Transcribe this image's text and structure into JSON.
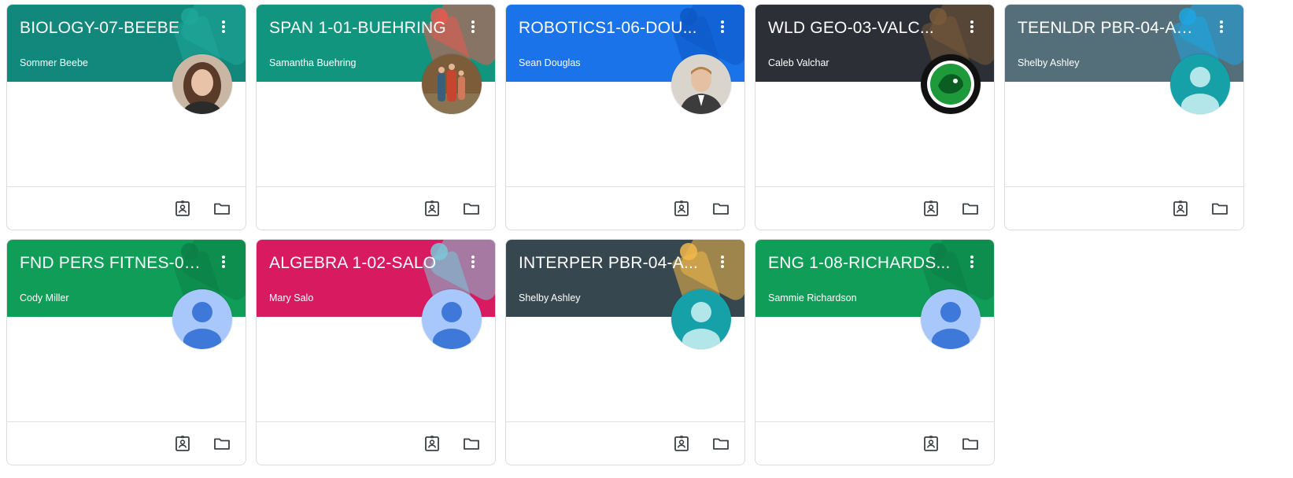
{
  "classes": [
    {
      "title": "BIOLOGY-07-BEEBE",
      "teacher": "Sommer Beebe",
      "header_color": "#12877b",
      "accent_color": "#1fa79a",
      "avatar": "photo-woman",
      "avatar_bg": "#c9b6a3",
      "avatar_fg": "#5a3b2a"
    },
    {
      "title": "SPAN 1-01-BUEHRING",
      "teacher": "Samantha Buehring",
      "header_color": "#12957f",
      "accent_color": "#e85a4f",
      "avatar": "photo-family",
      "avatar_bg": "#7d5c3a",
      "avatar_fg": "#c5452f"
    },
    {
      "title": "ROBOTICS1-06-DOU...",
      "teacher": "Sean Douglas",
      "header_color": "#1a73e8",
      "accent_color": "#0d57c6",
      "avatar": "photo-man",
      "avatar_bg": "#d9d4cc",
      "avatar_fg": "#3c3c3c"
    },
    {
      "title": "WLD GEO-03-VALC...",
      "teacher": "Caleb Valchar",
      "header_color": "#2c2f36",
      "accent_color": "#7a5a3a",
      "avatar": "photo-logo",
      "avatar_bg": "#111111",
      "avatar_fg": "#1e9a3a"
    },
    {
      "title": "TEENLDR PBR-04-AS...",
      "teacher": "Shelby Ashley",
      "header_color": "#546e7a",
      "accent_color": "#1ea6e0",
      "avatar": "default-teal",
      "avatar_bg": "#16a0a8",
      "avatar_fg": "#b2e6e8"
    },
    {
      "title": "FND PERS FITNES-05...",
      "teacher": "Cody Miller",
      "header_color": "#0f9d58",
      "accent_color": "#0c7f47",
      "avatar": "default-blue",
      "avatar_bg": "#a8c7fa",
      "avatar_fg": "#3e78d9"
    },
    {
      "title": "ALGEBRA 1-02-SALO",
      "teacher": "Mary Salo",
      "header_color": "#d81b60",
      "accent_color": "#7cc7d9",
      "avatar": "default-blue",
      "avatar_bg": "#a8c7fa",
      "avatar_fg": "#3e78d9"
    },
    {
      "title": "INTERPER PBR-04-A...",
      "teacher": "Shelby Ashley",
      "header_color": "#37474f",
      "accent_color": "#f2b84b",
      "avatar": "default-teal",
      "avatar_bg": "#16a0a8",
      "avatar_fg": "#b2e6e8"
    },
    {
      "title": "ENG 1-08-RICHARDS...",
      "teacher": "Sammie Richardson",
      "header_color": "#0f9d58",
      "accent_color": "#0c7f47",
      "avatar": "default-blue",
      "avatar_bg": "#a8c7fa",
      "avatar_fg": "#3e78d9"
    }
  ],
  "icons": {
    "menu": "more-vert-icon",
    "assignments": "assignment-ind-icon",
    "folder": "folder-icon"
  }
}
